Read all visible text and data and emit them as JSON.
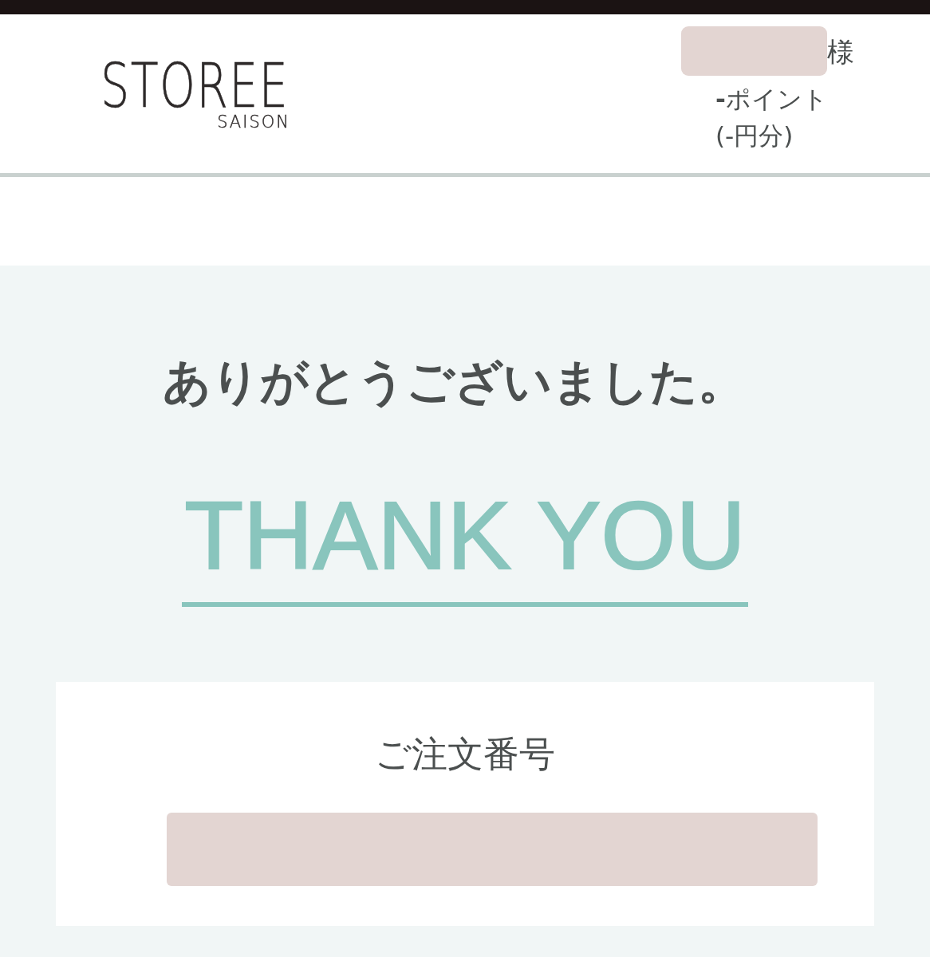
{
  "header": {
    "logo": {
      "wordmark": "STOREE",
      "subtitle": "SAISON"
    },
    "user": {
      "honorific": "様",
      "points": "**-**ポイント",
      "points_value": "(-円分)"
    }
  },
  "main": {
    "message": "ありがとうございました。",
    "headline": "THANK YOU",
    "order": {
      "label": "ご注文番号"
    }
  }
}
